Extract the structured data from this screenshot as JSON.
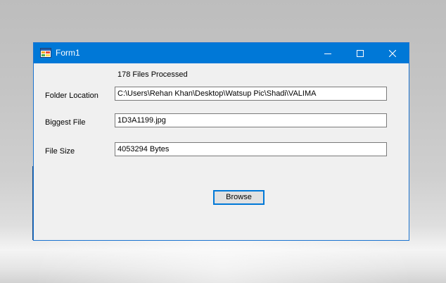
{
  "window": {
    "title": "Form1",
    "app_icon": "winforms-app-icon",
    "controls": {
      "minimize_icon": "minimize-icon",
      "maximize_icon": "maximize-icon",
      "close_icon": "close-icon"
    }
  },
  "status": {
    "files_processed": "178 Files Processed"
  },
  "fields": {
    "folder_location": {
      "label": "Folder Location",
      "value": "C:\\Users\\Rehan Khan\\Desktop\\Watsup Pic\\Shadi\\VALIMA"
    },
    "biggest_file": {
      "label": "Biggest File",
      "value": "1D3A1199.jpg"
    },
    "file_size": {
      "label": "File Size",
      "value": "4053294 Bytes"
    }
  },
  "actions": {
    "browse_label": "Browse"
  },
  "colors": {
    "titlebar": "#0078d7",
    "window_body": "#f0f0f0",
    "button_focus_border": "#0078d7"
  }
}
